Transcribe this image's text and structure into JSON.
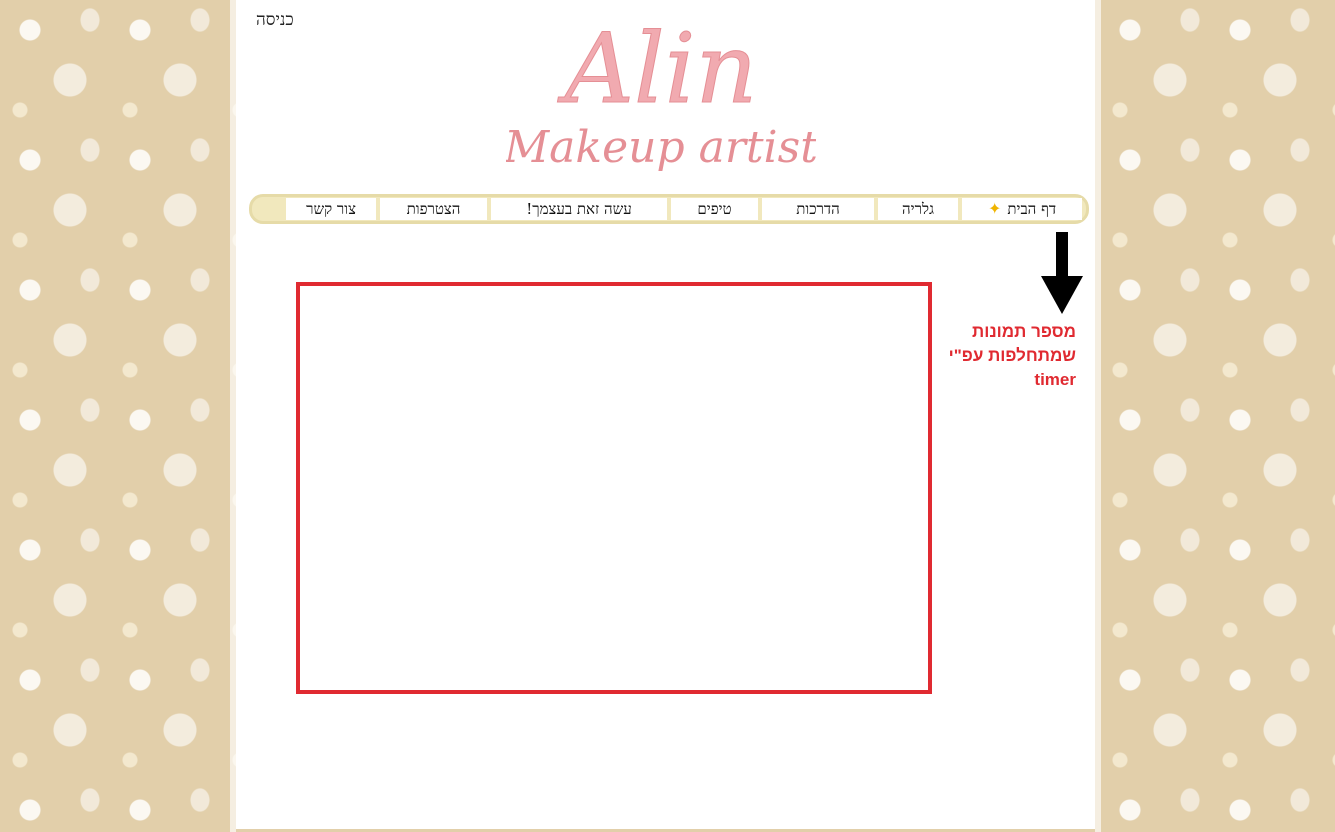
{
  "header": {
    "login_label": "כניסה",
    "logo_text_main": "Alin",
    "logo_text_sub": "Makeup artist"
  },
  "nav": {
    "items": [
      {
        "label": "דף הבית"
      },
      {
        "label": "גלריה"
      },
      {
        "label": "הדרכות"
      },
      {
        "label": "טיפים"
      },
      {
        "label": "עשה זאת בעצמך!"
      },
      {
        "label": "הצטרפות"
      },
      {
        "label": "צור קשר"
      }
    ]
  },
  "annotation": {
    "line1": "מספר תמונות",
    "line2": "שמתחלפות עפ\"י",
    "line3": "timer"
  },
  "colors": {
    "logo_pink": "#ef9ea0",
    "annotation_red": "#e02a31",
    "nav_bg": "#f1e8bd"
  }
}
